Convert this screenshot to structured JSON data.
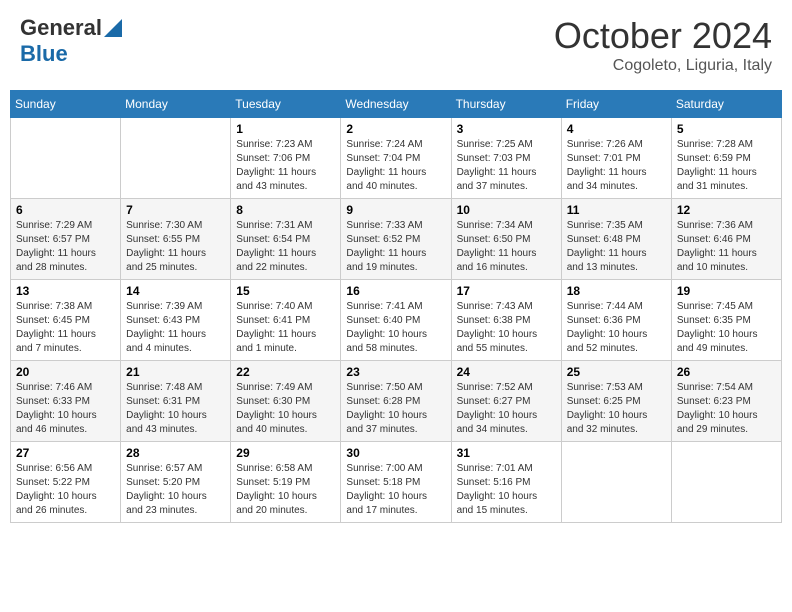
{
  "header": {
    "logo_general": "General",
    "logo_blue": "Blue",
    "title": "October 2024",
    "location": "Cogoleto, Liguria, Italy"
  },
  "columns": [
    "Sunday",
    "Monday",
    "Tuesday",
    "Wednesday",
    "Thursday",
    "Friday",
    "Saturday"
  ],
  "weeks": [
    [
      {
        "day": "",
        "info": ""
      },
      {
        "day": "",
        "info": ""
      },
      {
        "day": "1",
        "info": "Sunrise: 7:23 AM\nSunset: 7:06 PM\nDaylight: 11 hours and 43 minutes."
      },
      {
        "day": "2",
        "info": "Sunrise: 7:24 AM\nSunset: 7:04 PM\nDaylight: 11 hours and 40 minutes."
      },
      {
        "day": "3",
        "info": "Sunrise: 7:25 AM\nSunset: 7:03 PM\nDaylight: 11 hours and 37 minutes."
      },
      {
        "day": "4",
        "info": "Sunrise: 7:26 AM\nSunset: 7:01 PM\nDaylight: 11 hours and 34 minutes."
      },
      {
        "day": "5",
        "info": "Sunrise: 7:28 AM\nSunset: 6:59 PM\nDaylight: 11 hours and 31 minutes."
      }
    ],
    [
      {
        "day": "6",
        "info": "Sunrise: 7:29 AM\nSunset: 6:57 PM\nDaylight: 11 hours and 28 minutes."
      },
      {
        "day": "7",
        "info": "Sunrise: 7:30 AM\nSunset: 6:55 PM\nDaylight: 11 hours and 25 minutes."
      },
      {
        "day": "8",
        "info": "Sunrise: 7:31 AM\nSunset: 6:54 PM\nDaylight: 11 hours and 22 minutes."
      },
      {
        "day": "9",
        "info": "Sunrise: 7:33 AM\nSunset: 6:52 PM\nDaylight: 11 hours and 19 minutes."
      },
      {
        "day": "10",
        "info": "Sunrise: 7:34 AM\nSunset: 6:50 PM\nDaylight: 11 hours and 16 minutes."
      },
      {
        "day": "11",
        "info": "Sunrise: 7:35 AM\nSunset: 6:48 PM\nDaylight: 11 hours and 13 minutes."
      },
      {
        "day": "12",
        "info": "Sunrise: 7:36 AM\nSunset: 6:46 PM\nDaylight: 11 hours and 10 minutes."
      }
    ],
    [
      {
        "day": "13",
        "info": "Sunrise: 7:38 AM\nSunset: 6:45 PM\nDaylight: 11 hours and 7 minutes."
      },
      {
        "day": "14",
        "info": "Sunrise: 7:39 AM\nSunset: 6:43 PM\nDaylight: 11 hours and 4 minutes."
      },
      {
        "day": "15",
        "info": "Sunrise: 7:40 AM\nSunset: 6:41 PM\nDaylight: 11 hours and 1 minute."
      },
      {
        "day": "16",
        "info": "Sunrise: 7:41 AM\nSunset: 6:40 PM\nDaylight: 10 hours and 58 minutes."
      },
      {
        "day": "17",
        "info": "Sunrise: 7:43 AM\nSunset: 6:38 PM\nDaylight: 10 hours and 55 minutes."
      },
      {
        "day": "18",
        "info": "Sunrise: 7:44 AM\nSunset: 6:36 PM\nDaylight: 10 hours and 52 minutes."
      },
      {
        "day": "19",
        "info": "Sunrise: 7:45 AM\nSunset: 6:35 PM\nDaylight: 10 hours and 49 minutes."
      }
    ],
    [
      {
        "day": "20",
        "info": "Sunrise: 7:46 AM\nSunset: 6:33 PM\nDaylight: 10 hours and 46 minutes."
      },
      {
        "day": "21",
        "info": "Sunrise: 7:48 AM\nSunset: 6:31 PM\nDaylight: 10 hours and 43 minutes."
      },
      {
        "day": "22",
        "info": "Sunrise: 7:49 AM\nSunset: 6:30 PM\nDaylight: 10 hours and 40 minutes."
      },
      {
        "day": "23",
        "info": "Sunrise: 7:50 AM\nSunset: 6:28 PM\nDaylight: 10 hours and 37 minutes."
      },
      {
        "day": "24",
        "info": "Sunrise: 7:52 AM\nSunset: 6:27 PM\nDaylight: 10 hours and 34 minutes."
      },
      {
        "day": "25",
        "info": "Sunrise: 7:53 AM\nSunset: 6:25 PM\nDaylight: 10 hours and 32 minutes."
      },
      {
        "day": "26",
        "info": "Sunrise: 7:54 AM\nSunset: 6:23 PM\nDaylight: 10 hours and 29 minutes."
      }
    ],
    [
      {
        "day": "27",
        "info": "Sunrise: 6:56 AM\nSunset: 5:22 PM\nDaylight: 10 hours and 26 minutes."
      },
      {
        "day": "28",
        "info": "Sunrise: 6:57 AM\nSunset: 5:20 PM\nDaylight: 10 hours and 23 minutes."
      },
      {
        "day": "29",
        "info": "Sunrise: 6:58 AM\nSunset: 5:19 PM\nDaylight: 10 hours and 20 minutes."
      },
      {
        "day": "30",
        "info": "Sunrise: 7:00 AM\nSunset: 5:18 PM\nDaylight: 10 hours and 17 minutes."
      },
      {
        "day": "31",
        "info": "Sunrise: 7:01 AM\nSunset: 5:16 PM\nDaylight: 10 hours and 15 minutes."
      },
      {
        "day": "",
        "info": ""
      },
      {
        "day": "",
        "info": ""
      }
    ]
  ]
}
